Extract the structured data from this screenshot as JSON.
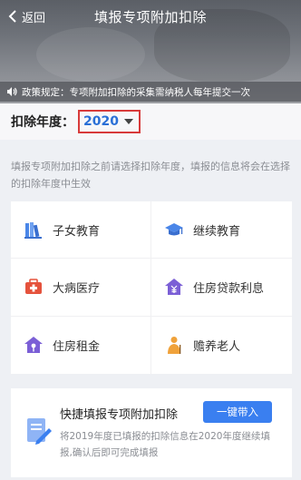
{
  "header": {
    "back_label": "返回",
    "title": "填报专项附加扣除",
    "policy_text": "政策规定：专项附加扣除的采集需纳税人每年提交一次"
  },
  "year": {
    "label": "扣除年度：",
    "value": "2020"
  },
  "hint": "填报专项附加扣除之前请选择扣除年度，填报的信息将会在选择的扣除年度中生效",
  "items": [
    {
      "label": "子女教育",
      "icon": "books-icon"
    },
    {
      "label": "继续教育",
      "icon": "graduation-cap-icon"
    },
    {
      "label": "大病医疗",
      "icon": "medical-kit-icon"
    },
    {
      "label": "住房贷款利息",
      "icon": "house-yen-icon"
    },
    {
      "label": "住房租金",
      "icon": "house-key-icon"
    },
    {
      "label": "赡养老人",
      "icon": "elderly-person-icon"
    }
  ],
  "quick": {
    "title": "快捷填报专项附加扣除",
    "button": "一键带入",
    "desc": "将2019年度已填报的扣除信息在2020年度继续填报,确认后即可完成填报"
  },
  "colors": {
    "accent": "#3a7ff0",
    "year_value": "#2a6fd6",
    "highlight_box": "#d83a3a"
  }
}
